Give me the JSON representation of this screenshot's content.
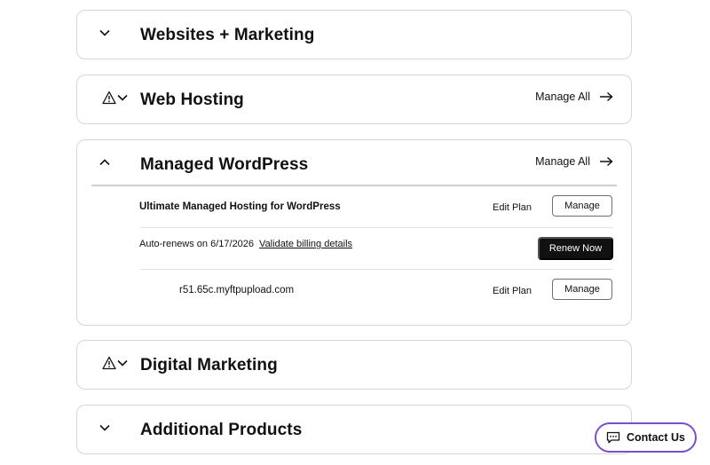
{
  "sections": [
    {
      "title": "Websites + Marketing",
      "expanded": false,
      "warning": false
    },
    {
      "title": "Web Hosting",
      "expanded": false,
      "warning": true,
      "manage_all": "Manage All"
    },
    {
      "title": "Managed WordPress",
      "expanded": true,
      "warning": false,
      "manage_all": "Manage All"
    },
    {
      "title": "Digital Marketing",
      "expanded": false,
      "warning": true
    },
    {
      "title": "Additional Products",
      "expanded": false,
      "warning": false
    }
  ],
  "wordpress": {
    "plan_name": "Ultimate Managed Hosting for WordPress",
    "edit_plan_label": "Edit Plan",
    "manage_label": "Manage",
    "auto_renew_text": "Auto-renews on 6/17/2026",
    "validate_link": "Validate billing details",
    "renew_now_label": "Renew Now",
    "site_domain": "r51.65c.myftpupload.com",
    "site_edit_plan_label": "Edit Plan",
    "site_manage_label": "Manage"
  },
  "contact": {
    "label": "Contact Us"
  },
  "colors": {
    "contact_border": "#7a4fc9",
    "renew_button": "#111111"
  }
}
